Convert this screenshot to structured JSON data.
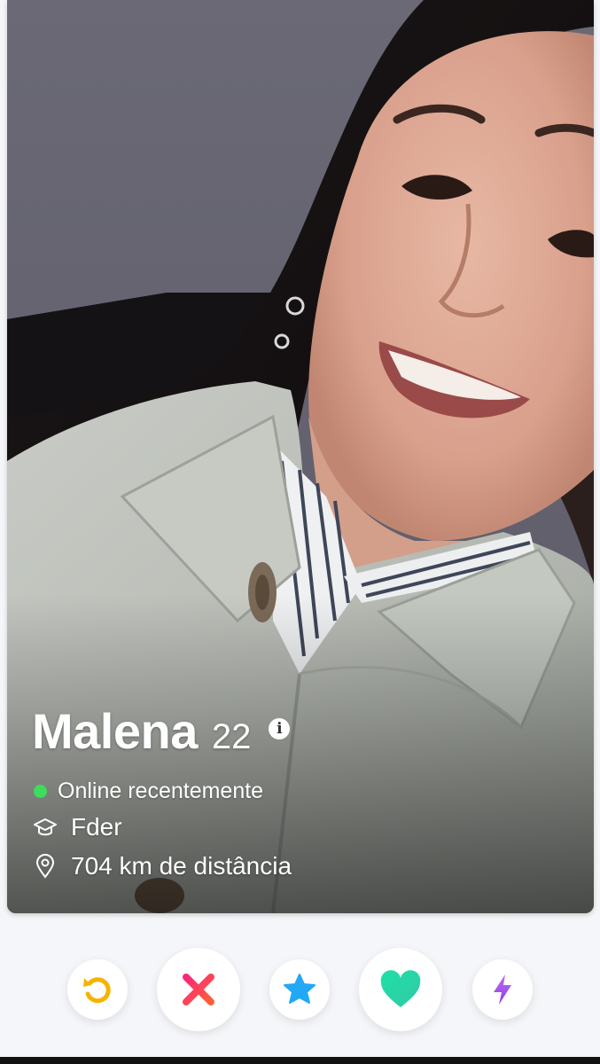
{
  "profile": {
    "name": "Malena",
    "age": "22",
    "info_icon": "info-icon",
    "status": "Online recentemente",
    "status_color": "#3ddc5a",
    "school": "Fder",
    "school_icon": "graduation-cap-icon",
    "distance": "704 km de distância",
    "distance_icon": "location-pin-icon"
  },
  "actions": [
    {
      "name": "rewind",
      "icon": "rewind-icon",
      "color": "#f5b400"
    },
    {
      "name": "nope",
      "icon": "close-icon",
      "color": "#fd4e63"
    },
    {
      "name": "super-like",
      "icon": "star-icon",
      "color": "#22a8f5"
    },
    {
      "name": "like",
      "icon": "heart-icon",
      "color": "#27d9a6"
    },
    {
      "name": "boost",
      "icon": "lightning-icon",
      "color": "#a24ee8"
    }
  ]
}
